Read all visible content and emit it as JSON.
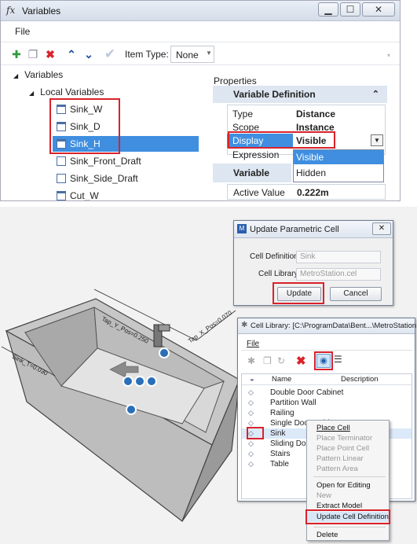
{
  "variables_window": {
    "title": "Variables",
    "title_icon": "fx",
    "menu": {
      "file": "File"
    },
    "toolbar": {
      "item_type_label": "Item Type:",
      "item_type_value": "None"
    },
    "tree": {
      "root": "Variables",
      "group": "Local Variables",
      "items": [
        "Sink_W",
        "Sink_D",
        "Sink_H",
        "Sink_Front_Draft",
        "Sink_Side_Draft",
        "Cut_W"
      ],
      "selected": "Sink_H"
    },
    "properties": {
      "header": "Properties",
      "section1": "Variable Definition",
      "rows": [
        {
          "key": "Type",
          "value": "Distance"
        },
        {
          "key": "Scope",
          "value": "Instance"
        },
        {
          "key": "Display",
          "value": "Visible"
        },
        {
          "key": "Expression",
          "value": ""
        }
      ],
      "dropdown_options": [
        "Visible",
        "Hidden"
      ],
      "section2": "Variable",
      "active_value_label": "Active Value",
      "active_value": "0.222m"
    }
  },
  "scene": {
    "dimension_labels": {
      "tap_y": "Tap_Y_Pos=0.250",
      "tap_x": "Tap_X_Pos=0.070",
      "sink_t": "Sink_T=0.030"
    }
  },
  "update_dialog": {
    "title": "Update Parametric Cell",
    "cell_definition_label": "Cell Definition:",
    "cell_definition_value": "Sink",
    "cell_library_label": "Cell Library:",
    "cell_library_value": "MetroStation.cel",
    "update_button": "Update",
    "cancel_button": "Cancel"
  },
  "cell_library": {
    "title": "Cell Library: [C:\\ProgramData\\Bent...\\MetroStation.cel]",
    "menu_file": "File",
    "columns": [
      "Name",
      "Description"
    ],
    "items": [
      "Double Door Cabinet",
      "Partition Wall",
      "Railing",
      "Single Door Cabinet",
      "Sink",
      "Sliding Doo",
      "Stairs",
      "Table"
    ],
    "selected": "Sink"
  },
  "context_menu": {
    "items": [
      {
        "label": "Place Cell",
        "enabled": true
      },
      {
        "label": "Place Terminator",
        "enabled": false
      },
      {
        "label": "Place Point Cell",
        "enabled": false
      },
      {
        "label": "Pattern Linear",
        "enabled": false
      },
      {
        "label": "Pattern Area",
        "enabled": false
      },
      {
        "label": "Open for Editing",
        "enabled": true
      },
      {
        "label": "New",
        "enabled": false
      },
      {
        "label": "Extract Model",
        "enabled": true
      },
      {
        "label": "Update Cell Definition",
        "enabled": true
      },
      {
        "label": "Delete",
        "enabled": true
      }
    ]
  },
  "colors": {
    "selection_blue": "#3f8ee0",
    "highlight_red": "#d9222a",
    "section_bg": "#dde6f1"
  }
}
